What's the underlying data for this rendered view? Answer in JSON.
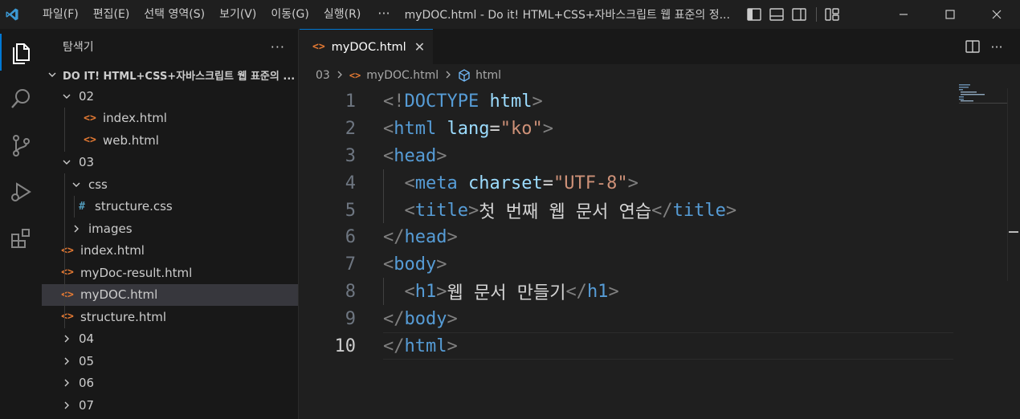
{
  "titlebar": {
    "menus": [
      "파일(F)",
      "편집(E)",
      "선택 영역(S)",
      "보기(V)",
      "이동(G)",
      "실행(R)"
    ],
    "more": "···",
    "window_title": "myDOC.html - Do it! HTML+CSS+자바스크립트 웹 표준의 정..."
  },
  "sidebar": {
    "title": "탐색기",
    "more": "···",
    "root": "DO IT! HTML+CSS+자바스크립트 웹 표준의 ...",
    "rows": [
      {
        "label": "02",
        "icon": "chevron-down"
      },
      {
        "label": "index.html",
        "icon": "html"
      },
      {
        "label": "web.html",
        "icon": "html"
      },
      {
        "label": "03",
        "icon": "chevron-down"
      },
      {
        "label": "css",
        "icon": "chevron-down"
      },
      {
        "label": "structure.css",
        "icon": "css",
        "glyph": "#"
      },
      {
        "label": "images",
        "icon": "chevron-right"
      },
      {
        "label": "index.html",
        "icon": "html"
      },
      {
        "label": "myDoc-result.html",
        "icon": "html"
      },
      {
        "label": "myDOC.html",
        "icon": "html"
      },
      {
        "label": "structure.html",
        "icon": "html"
      },
      {
        "label": "04",
        "icon": "chevron-right"
      },
      {
        "label": "05",
        "icon": "chevron-right"
      },
      {
        "label": "06",
        "icon": "chevron-right"
      },
      {
        "label": "07",
        "icon": "chevron-right"
      }
    ]
  },
  "editor": {
    "tab": {
      "label": "myDOC.html",
      "icon": "<>",
      "close": "✕"
    },
    "breadcrumb": {
      "folder": "03",
      "file": "myDOC.html",
      "symbol": "html"
    },
    "lines": [
      {
        "n": "1",
        "tokens": [
          [
            "tg",
            "<!"
          ],
          [
            "tn",
            "DOCTYPE"
          ],
          [
            "tx",
            " "
          ],
          [
            "an",
            "html"
          ],
          [
            "tg",
            ">"
          ]
        ]
      },
      {
        "n": "2",
        "tokens": [
          [
            "tg",
            "<"
          ],
          [
            "tn",
            "html"
          ],
          [
            "tx",
            " "
          ],
          [
            "an",
            "lang"
          ],
          [
            "eq",
            "="
          ],
          [
            "av",
            "\"ko\""
          ],
          [
            "tg",
            ">"
          ]
        ]
      },
      {
        "n": "3",
        "tokens": [
          [
            "tg",
            "<"
          ],
          [
            "tn",
            "head"
          ],
          [
            "tg",
            ">"
          ]
        ]
      },
      {
        "n": "4",
        "tokens": [
          [
            "tx",
            "  "
          ],
          [
            "tg",
            "<"
          ],
          [
            "tn",
            "meta"
          ],
          [
            "tx",
            " "
          ],
          [
            "an",
            "charset"
          ],
          [
            "eq",
            "="
          ],
          [
            "av",
            "\"UTF-8\""
          ],
          [
            "tg",
            ">"
          ]
        ]
      },
      {
        "n": "5",
        "tokens": [
          [
            "tx",
            "  "
          ],
          [
            "tg",
            "<"
          ],
          [
            "tn",
            "title"
          ],
          [
            "tg",
            ">"
          ],
          [
            "tx",
            "첫 번째 웹 문서 연습"
          ],
          [
            "tg",
            "</"
          ],
          [
            "tn",
            "title"
          ],
          [
            "tg",
            ">"
          ]
        ]
      },
      {
        "n": "6",
        "tokens": [
          [
            "tg",
            "</"
          ],
          [
            "tn",
            "head"
          ],
          [
            "tg",
            ">"
          ]
        ]
      },
      {
        "n": "7",
        "tokens": [
          [
            "tg",
            "<"
          ],
          [
            "tn",
            "body"
          ],
          [
            "tg",
            ">"
          ]
        ]
      },
      {
        "n": "8",
        "tokens": [
          [
            "tx",
            "  "
          ],
          [
            "tg",
            "<"
          ],
          [
            "tn",
            "h1"
          ],
          [
            "tg",
            ">"
          ],
          [
            "tx",
            "웹 문서 만들기"
          ],
          [
            "tg",
            "</"
          ],
          [
            "tn",
            "h1"
          ],
          [
            "tg",
            ">"
          ]
        ]
      },
      {
        "n": "9",
        "tokens": [
          [
            "tg",
            "</"
          ],
          [
            "tn",
            "body"
          ],
          [
            "tg",
            ">"
          ]
        ]
      },
      {
        "n": "10",
        "tokens": [
          [
            "tg",
            "</"
          ],
          [
            "tn",
            "html"
          ],
          [
            "tg",
            ">"
          ]
        ]
      }
    ]
  },
  "colors": {
    "accent": "#0078d4",
    "html_icon": "#e37933",
    "css_icon": "#519aba"
  }
}
